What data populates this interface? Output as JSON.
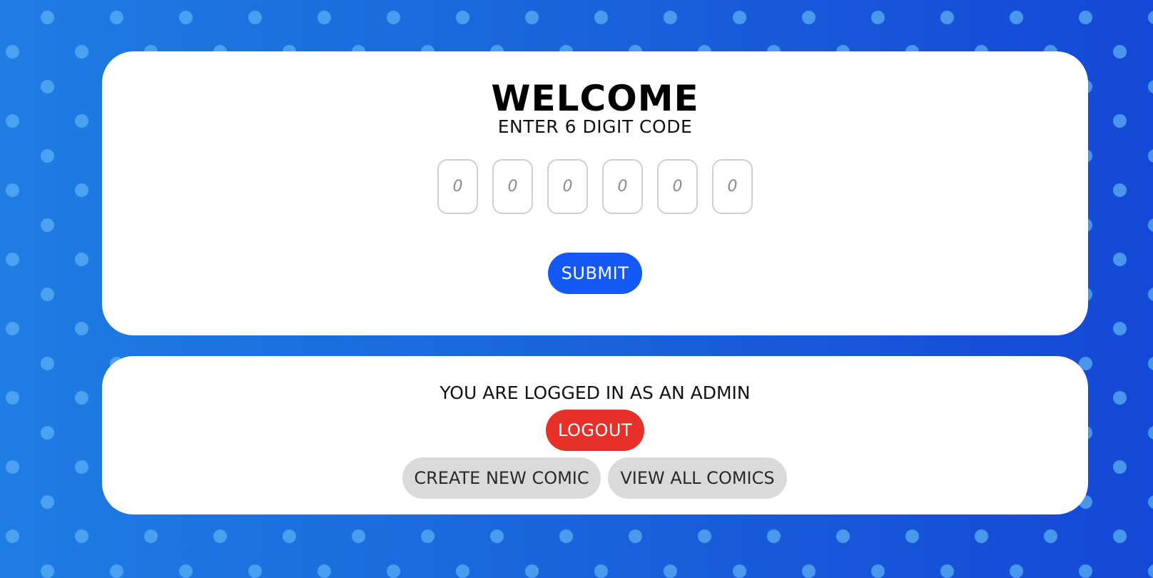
{
  "login_card": {
    "title": "WELCOME",
    "subtitle": "ENTER 6 DIGIT CODE",
    "code_digits": [
      {
        "placeholder": "0",
        "value": ""
      },
      {
        "placeholder": "0",
        "value": ""
      },
      {
        "placeholder": "0",
        "value": ""
      },
      {
        "placeholder": "0",
        "value": ""
      },
      {
        "placeholder": "0",
        "value": ""
      },
      {
        "placeholder": "0",
        "value": ""
      }
    ],
    "submit_label": "SUBMIT"
  },
  "admin_card": {
    "status_text": "YOU ARE LOGGED IN AS AN ADMIN",
    "logout_label": "LOGOUT",
    "create_label": "CREATE NEW COMIC",
    "view_all_label": "VIEW ALL COMICS"
  },
  "colors": {
    "background": "#1a6fe0",
    "submit": "#1458f5",
    "logout": "#e8302b",
    "secondary_button": "#dadada",
    "card": "#ffffff"
  }
}
